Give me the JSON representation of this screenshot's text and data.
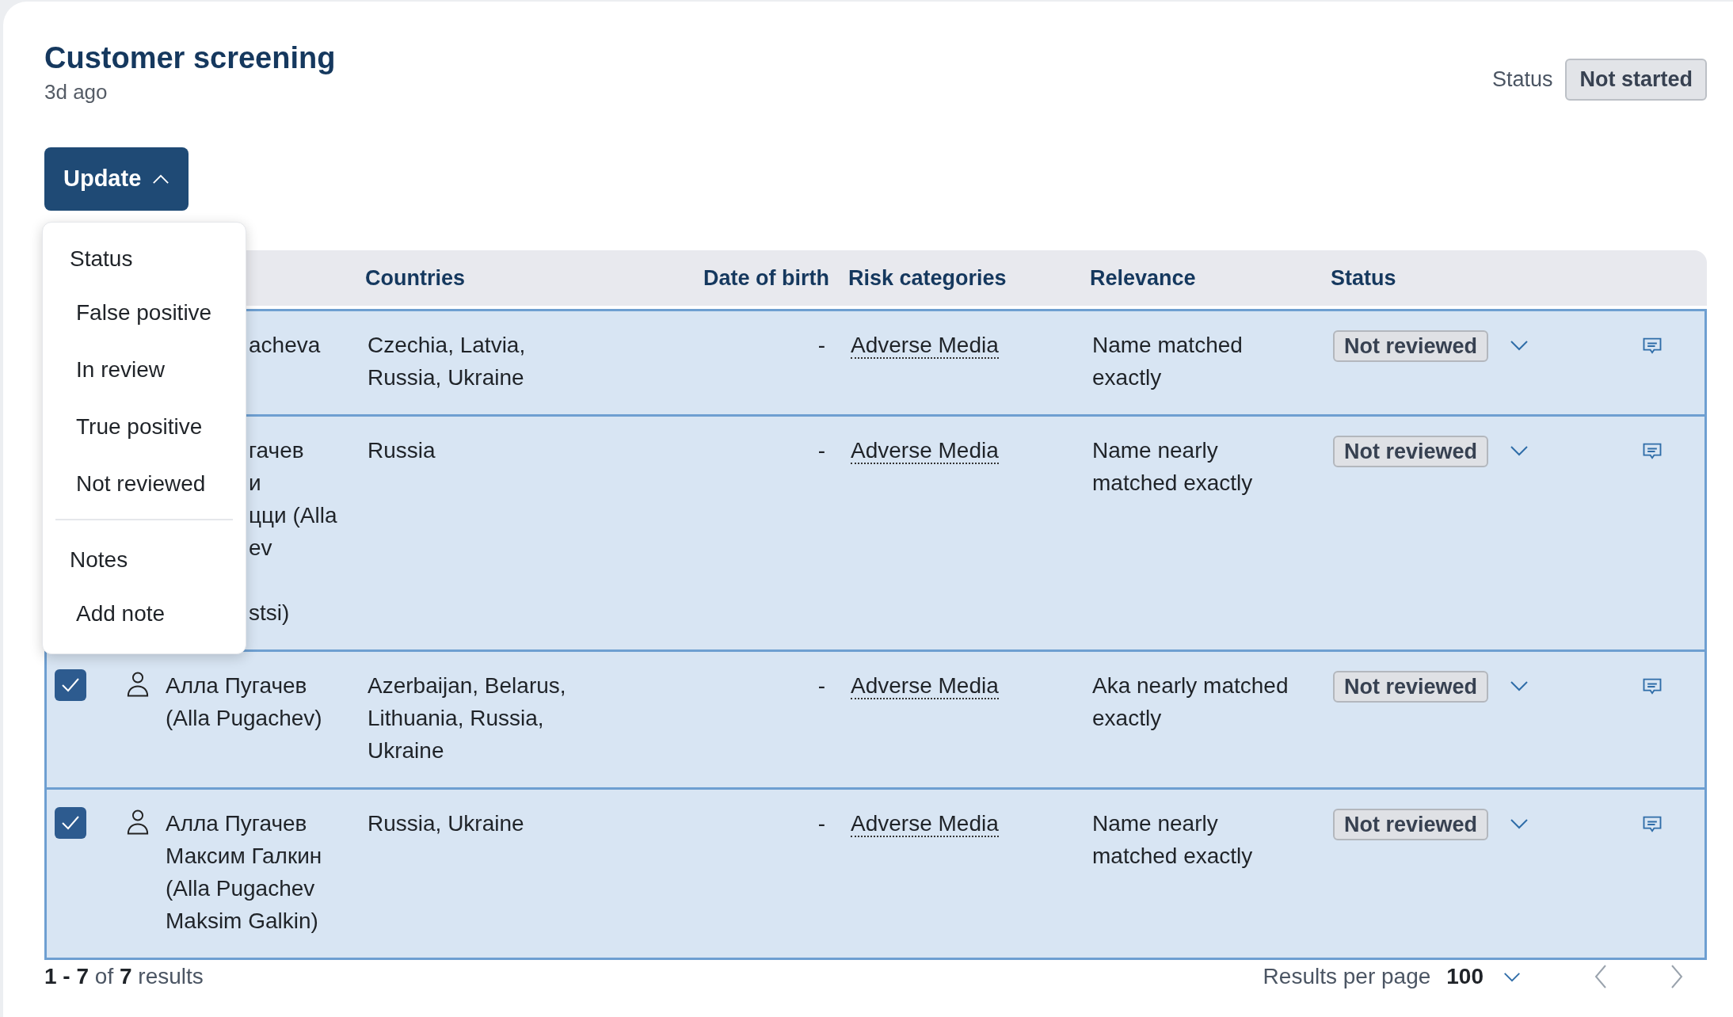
{
  "header": {
    "title": "Customer screening",
    "subtitle": "3d ago",
    "status_label": "Status",
    "status_value": "Not started"
  },
  "update_button": {
    "label": "Update",
    "expanded": true
  },
  "menu": {
    "sections": [
      {
        "heading": "Status",
        "items": [
          "False positive",
          "In review",
          "True positive",
          "Not reviewed"
        ]
      },
      {
        "heading": "Notes",
        "items": [
          "Add note"
        ]
      }
    ]
  },
  "table": {
    "columns": [
      "Countries",
      "Date of birth",
      "Risk categories",
      "Relevance",
      "Status"
    ],
    "rows": [
      {
        "selected": true,
        "covered": true,
        "name_lines": [
          "acheva"
        ],
        "countries": "Czechia, Latvia, Russia, Ukraine",
        "date_of_birth": "-",
        "risk_category": "Adverse Media",
        "relevance": "Name matched exactly",
        "status": "Not reviewed"
      },
      {
        "selected": true,
        "covered": true,
        "name_lines": [
          "гачев",
          "и",
          "цци (Alla",
          "ev",
          "stsi)"
        ],
        "countries": "Russia",
        "date_of_birth": "-",
        "risk_category": "Adverse Media",
        "relevance": "Name nearly matched exactly",
        "status": "Not reviewed"
      },
      {
        "selected": true,
        "covered": false,
        "checked": true,
        "name_lines": [
          "Алла Пугачев",
          "(Alla Pugachev)"
        ],
        "countries": "Azerbaijan, Belarus, Lithuania, Russia, Ukraine",
        "date_of_birth": "-",
        "risk_category": "Adverse Media",
        "relevance": "Aka nearly matched exactly",
        "status": "Not reviewed"
      },
      {
        "selected": true,
        "covered": false,
        "checked": true,
        "name_lines": [
          "Алла Пугачев",
          "Максим Галкин",
          "(Alla Pugachev",
          "Maksim Galkin)"
        ],
        "countries": "Russia, Ukraine",
        "date_of_birth": "-",
        "risk_category": "Adverse Media",
        "relevance": "Name nearly matched exactly",
        "status": "Not reviewed"
      }
    ]
  },
  "footer": {
    "results": "**1 - 7** of **7** results",
    "per_page_label": "Results per page",
    "per_page_value": "100"
  }
}
